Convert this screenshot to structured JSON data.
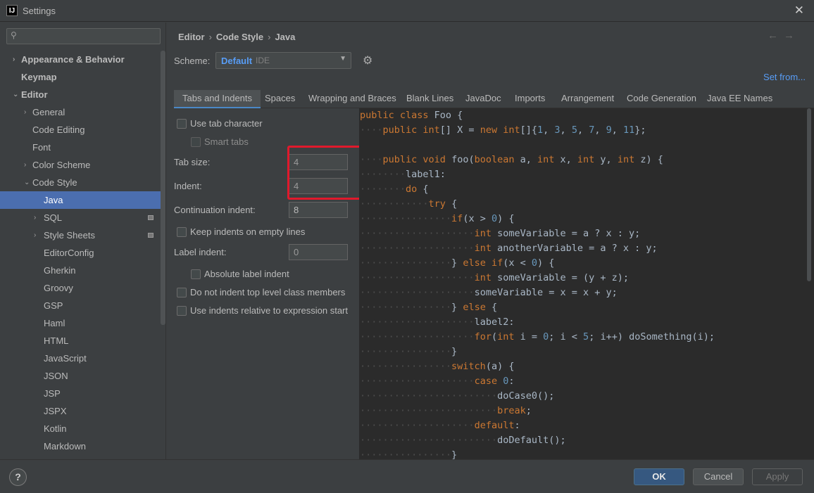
{
  "window": {
    "title": "Settings",
    "app_icon": "IJ",
    "close_glyph": "✕"
  },
  "sidebar": {
    "search_placeholder": "",
    "items": [
      {
        "label": "Appearance & Behavior",
        "arrow": "›",
        "bold": true,
        "indent": 0
      },
      {
        "label": "Keymap",
        "arrow": "",
        "bold": true,
        "indent": 0
      },
      {
        "label": "Editor",
        "arrow": "⌄",
        "bold": true,
        "indent": 0
      },
      {
        "label": "General",
        "arrow": "›",
        "indent": 1
      },
      {
        "label": "Code Editing",
        "arrow": "",
        "indent": 1
      },
      {
        "label": "Font",
        "arrow": "",
        "indent": 1
      },
      {
        "label": "Color Scheme",
        "arrow": "›",
        "indent": 1
      },
      {
        "label": "Code Style",
        "arrow": "⌄",
        "indent": 1
      },
      {
        "label": "Java",
        "arrow": "",
        "indent": 2,
        "selected": true
      },
      {
        "label": "SQL",
        "arrow": "›",
        "indent": 2,
        "badge": true
      },
      {
        "label": "Style Sheets",
        "arrow": "›",
        "indent": 2,
        "badge": true
      },
      {
        "label": "EditorConfig",
        "arrow": "",
        "indent": 2
      },
      {
        "label": "Gherkin",
        "arrow": "",
        "indent": 2
      },
      {
        "label": "Groovy",
        "arrow": "",
        "indent": 2
      },
      {
        "label": "GSP",
        "arrow": "",
        "indent": 2
      },
      {
        "label": "Haml",
        "arrow": "",
        "indent": 2
      },
      {
        "label": "HTML",
        "arrow": "",
        "indent": 2
      },
      {
        "label": "JavaScript",
        "arrow": "",
        "indent": 2
      },
      {
        "label": "JSON",
        "arrow": "",
        "indent": 2
      },
      {
        "label": "JSP",
        "arrow": "",
        "indent": 2
      },
      {
        "label": "JSPX",
        "arrow": "",
        "indent": 2
      },
      {
        "label": "Kotlin",
        "arrow": "",
        "indent": 2
      },
      {
        "label": "Markdown",
        "arrow": "",
        "indent": 2
      }
    ]
  },
  "breadcrumb": [
    "Editor",
    "Code Style",
    "Java"
  ],
  "breadcrumb_sep": "›",
  "nav": {
    "back": "←",
    "forward": "→"
  },
  "scheme": {
    "label": "Scheme:",
    "value": "Default",
    "sub": "IDE",
    "caret": "▼",
    "set_from": "Set from..."
  },
  "tabs": [
    {
      "label": "Tabs and Indents",
      "active": true
    },
    {
      "label": "Spaces"
    },
    {
      "label": "Wrapping and Braces"
    },
    {
      "label": "Blank Lines"
    },
    {
      "label": "JavaDoc"
    },
    {
      "label": "Imports"
    },
    {
      "label": "Arrangement"
    },
    {
      "label": "Code Generation"
    },
    {
      "label": "Java EE Names"
    }
  ],
  "options": {
    "use_tab_character": "Use tab character",
    "smart_tabs": "Smart tabs",
    "tab_size_label": "Tab size:",
    "tab_size": "4",
    "indent_label": "Indent:",
    "indent": "4",
    "continuation_label": "Continuation indent:",
    "continuation": "8",
    "keep_indents": "Keep indents on empty lines",
    "label_indent_label": "Label indent:",
    "label_indent": "0",
    "absolute_label": "Absolute label indent",
    "no_indent_top": "Do not indent top level class members",
    "relative_expr": "Use indents relative to expression start"
  },
  "code_lines": [
    [
      [
        0,
        ""
      ],
      [
        "kw",
        "public class "
      ],
      [
        "t",
        "Foo {"
      ]
    ],
    [
      [
        1,
        ""
      ],
      [
        "kw",
        "public int"
      ],
      [
        "t",
        "[] X = "
      ],
      [
        "kw",
        "new int"
      ],
      [
        "t",
        "[]{"
      ],
      [
        "num",
        "1"
      ],
      [
        "t",
        ", "
      ],
      [
        "num",
        "3"
      ],
      [
        "t",
        ", "
      ],
      [
        "num",
        "5"
      ],
      [
        "t",
        ", "
      ],
      [
        "num",
        "7"
      ],
      [
        "t",
        ", "
      ],
      [
        "num",
        "9"
      ],
      [
        "t",
        ", "
      ],
      [
        "num",
        "11"
      ],
      [
        "t",
        "};"
      ]
    ],
    [
      [
        0,
        ""
      ]
    ],
    [
      [
        1,
        ""
      ],
      [
        "kw",
        "public void "
      ],
      [
        "t",
        "foo("
      ],
      [
        "kw",
        "boolean "
      ],
      [
        "t",
        "a, "
      ],
      [
        "kw",
        "int "
      ],
      [
        "t",
        "x, "
      ],
      [
        "kw",
        "int "
      ],
      [
        "t",
        "y, "
      ],
      [
        "kw",
        "int "
      ],
      [
        "t",
        "z) {"
      ]
    ],
    [
      [
        2,
        ""
      ],
      [
        "t",
        "label1:"
      ]
    ],
    [
      [
        2,
        ""
      ],
      [
        "kw",
        "do "
      ],
      [
        "t",
        "{"
      ]
    ],
    [
      [
        3,
        ""
      ],
      [
        "kw",
        "try "
      ],
      [
        "t",
        "{"
      ]
    ],
    [
      [
        4,
        ""
      ],
      [
        "kw",
        "if"
      ],
      [
        "t",
        "(x > "
      ],
      [
        "num",
        "0"
      ],
      [
        "t",
        ") {"
      ]
    ],
    [
      [
        5,
        ""
      ],
      [
        "kw",
        "int "
      ],
      [
        "t",
        "someVariable = a ? x : y;"
      ]
    ],
    [
      [
        5,
        ""
      ],
      [
        "kw",
        "int "
      ],
      [
        "t",
        "anotherVariable = a ? x : y;"
      ]
    ],
    [
      [
        4,
        ""
      ],
      [
        "t",
        "} "
      ],
      [
        "kw",
        "else if"
      ],
      [
        "t",
        "(x < "
      ],
      [
        "num",
        "0"
      ],
      [
        "t",
        ") {"
      ]
    ],
    [
      [
        5,
        ""
      ],
      [
        "kw",
        "int "
      ],
      [
        "t",
        "someVariable = (y + z);"
      ]
    ],
    [
      [
        5,
        ""
      ],
      [
        "t",
        "someVariable = x = x + y;"
      ]
    ],
    [
      [
        4,
        ""
      ],
      [
        "t",
        "} "
      ],
      [
        "kw",
        "else "
      ],
      [
        "t",
        "{"
      ]
    ],
    [
      [
        5,
        ""
      ],
      [
        "t",
        "label2:"
      ]
    ],
    [
      [
        5,
        ""
      ],
      [
        "kw",
        "for"
      ],
      [
        "t",
        "("
      ],
      [
        "kw",
        "int "
      ],
      [
        "t",
        "i = "
      ],
      [
        "num",
        "0"
      ],
      [
        "t",
        "; i < "
      ],
      [
        "num",
        "5"
      ],
      [
        "t",
        "; i++) doSomething(i);"
      ]
    ],
    [
      [
        4,
        ""
      ],
      [
        "t",
        "}"
      ]
    ],
    [
      [
        4,
        ""
      ],
      [
        "kw",
        "switch"
      ],
      [
        "t",
        "(a) {"
      ]
    ],
    [
      [
        5,
        ""
      ],
      [
        "kw",
        "case "
      ],
      [
        "num",
        "0"
      ],
      [
        "t",
        ":"
      ]
    ],
    [
      [
        6,
        ""
      ],
      [
        "t",
        "doCase0();"
      ]
    ],
    [
      [
        6,
        ""
      ],
      [
        "kw",
        "break"
      ],
      [
        "t",
        ";"
      ]
    ],
    [
      [
        5,
        ""
      ],
      [
        "kw",
        "default"
      ],
      [
        "t",
        ":"
      ]
    ],
    [
      [
        6,
        ""
      ],
      [
        "t",
        "doDefault();"
      ]
    ],
    [
      [
        4,
        ""
      ],
      [
        "t",
        "}"
      ]
    ]
  ],
  "footer": {
    "help": "?",
    "ok": "OK",
    "cancel": "Cancel",
    "apply": "Apply"
  },
  "colors": {
    "accent": "#4b6eaf",
    "link": "#589df6",
    "keyword": "#cc7832",
    "number": "#6897bb",
    "highlight": "#e0192c"
  }
}
